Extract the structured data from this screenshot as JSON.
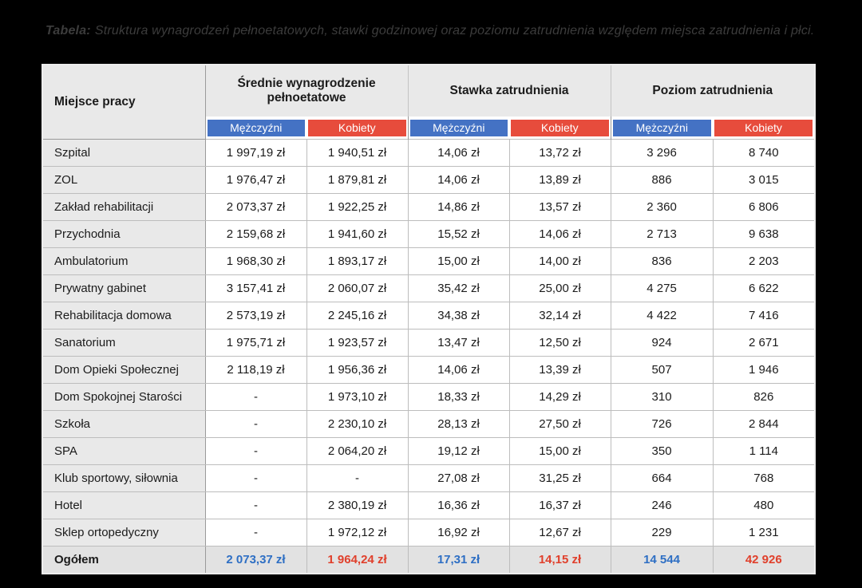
{
  "caption": {
    "label": "Tabela:",
    "text": "Struktura wynagrodzeń pełnoetatowych, stawki godzinowej oraz poziomu zatrudnienia względem miejsca zatrudnienia i płci."
  },
  "colors": {
    "header_male": "#4472c4",
    "header_female": "#e74c3c",
    "total_male": "#2e6fc4",
    "total_female": "#e0402c",
    "table_header_bg": "#e9e9e9",
    "total_row_bg": "#e2e2e2",
    "page_bg": "#000000",
    "caption_color": "#3c3c3c"
  },
  "chart_data": {
    "type": "table",
    "title": "Tabela: Struktura wynagrodzeń pełnoetatowych, stawki godzinowej oraz poziomu zatrudnienia względem miejsca zatrudnienia i płci.",
    "corner_header": "Miejsce pracy",
    "groups": [
      "Średnie wynagrodzenie pełnoetatowe",
      "Stawka zatrudnienia",
      "Poziom zatrudnienia"
    ],
    "subheaders": {
      "male": "Mężczyźni",
      "female": "Kobiety"
    },
    "rows": [
      {
        "label": "Szpital",
        "values": [
          "1 997,19 zł",
          "1 940,51 zł",
          "14,06 zł",
          "13,72 zł",
          "3 296",
          "8 740"
        ]
      },
      {
        "label": "ZOL",
        "values": [
          "1 976,47 zł",
          "1 879,81 zł",
          "14,06 zł",
          "13,89 zł",
          "886",
          "3 015"
        ]
      },
      {
        "label": "Zakład rehabilitacji",
        "values": [
          "2 073,37 zł",
          "1 922,25 zł",
          "14,86 zł",
          "13,57 zł",
          "2 360",
          "6 806"
        ]
      },
      {
        "label": "Przychodnia",
        "values": [
          "2 159,68 zł",
          "1 941,60 zł",
          "15,52 zł",
          "14,06 zł",
          "2 713",
          "9 638"
        ]
      },
      {
        "label": "Ambulatorium",
        "values": [
          "1 968,30 zł",
          "1 893,17 zł",
          "15,00 zł",
          "14,00 zł",
          "836",
          "2 203"
        ]
      },
      {
        "label": "Prywatny gabinet",
        "values": [
          "3 157,41 zł",
          "2 060,07 zł",
          "35,42 zł",
          "25,00 zł",
          "4 275",
          "6 622"
        ]
      },
      {
        "label": "Rehabilitacja domowa",
        "values": [
          "2 573,19 zł",
          "2 245,16 zł",
          "34,38 zł",
          "32,14 zł",
          "4 422",
          "7 416"
        ]
      },
      {
        "label": "Sanatorium",
        "values": [
          "1 975,71 zł",
          "1 923,57 zł",
          "13,47 zł",
          "12,50 zł",
          "924",
          "2 671"
        ]
      },
      {
        "label": "Dom Opieki Społecznej",
        "values": [
          "2 118,19 zł",
          "1 956,36 zł",
          "14,06 zł",
          "13,39 zł",
          "507",
          "1 946"
        ]
      },
      {
        "label": "Dom Spokojnej Starości",
        "values": [
          "-",
          "1 973,10 zł",
          "18,33 zł",
          "14,29 zł",
          "310",
          "826"
        ]
      },
      {
        "label": "Szkoła",
        "values": [
          "-",
          "2 230,10 zł",
          "28,13 zł",
          "27,50 zł",
          "726",
          "2 844"
        ]
      },
      {
        "label": "SPA",
        "values": [
          "-",
          "2 064,20 zł",
          "19,12 zł",
          "15,00 zł",
          "350",
          "1 114"
        ]
      },
      {
        "label": "Klub sportowy, siłownia",
        "values": [
          "-",
          "-",
          "27,08 zł",
          "31,25 zł",
          "664",
          "768"
        ]
      },
      {
        "label": "Hotel",
        "values": [
          "-",
          "2 380,19 zł",
          "16,36 zł",
          "16,37 zł",
          "246",
          "480"
        ]
      },
      {
        "label": "Sklep ortopedyczny",
        "values": [
          "-",
          "1 972,12 zł",
          "16,92 zł",
          "12,67 zł",
          "229",
          "1 231"
        ]
      },
      {
        "label": "Ogółem",
        "total": true,
        "values": [
          "2 073,37 zł",
          "1 964,24 zł",
          "17,31 zł",
          "14,15 zł",
          "14 544",
          "42 926"
        ]
      }
    ]
  }
}
